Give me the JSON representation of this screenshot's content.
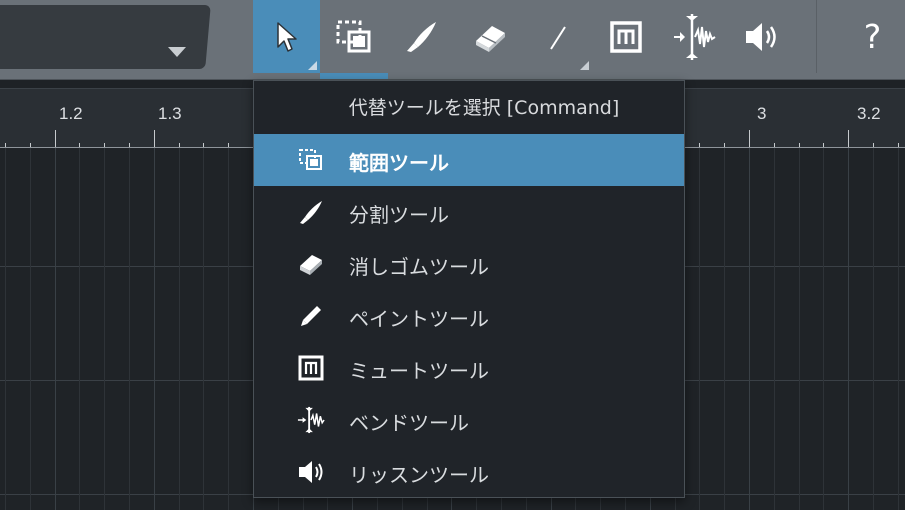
{
  "toolbar": {
    "tools": [
      {
        "name": "arrow-tool",
        "icon": "arrow-cursor-icon",
        "active": true,
        "has_submenu": true
      },
      {
        "name": "range-tool",
        "icon": "range-select-icon",
        "active": false,
        "has_submenu": false
      },
      {
        "name": "split-tool",
        "icon": "knife-icon",
        "active": false,
        "has_submenu": false
      },
      {
        "name": "eraser-tool",
        "icon": "eraser-icon",
        "active": false,
        "has_submenu": false
      },
      {
        "name": "paint-tool",
        "icon": "pencil-line-icon",
        "active": false,
        "has_submenu": true
      },
      {
        "name": "mute-tool",
        "icon": "mute-m-icon",
        "active": false,
        "has_submenu": false
      },
      {
        "name": "bend-tool",
        "icon": "bend-marker-icon",
        "active": false,
        "has_submenu": false
      },
      {
        "name": "listen-tool",
        "icon": "speaker-icon",
        "active": false,
        "has_submenu": false
      }
    ],
    "help_label": "?",
    "colors": {
      "toolbar": "#6a7178",
      "accent": "#4a8db9"
    }
  },
  "ruler": {
    "labels": [
      "1.2",
      "1.3",
      "3",
      "3.2"
    ]
  },
  "menu": {
    "header": "代替ツールを選択 [Command]",
    "items": [
      {
        "label": "範囲ツール",
        "icon": "range-select-icon",
        "selected": true
      },
      {
        "label": "分割ツール",
        "icon": "knife-icon",
        "selected": false
      },
      {
        "label": "消しゴムツール",
        "icon": "eraser-icon",
        "selected": false
      },
      {
        "label": "ペイントツール",
        "icon": "pencil-icon",
        "selected": false
      },
      {
        "label": "ミュートツール",
        "icon": "mute-m-icon",
        "selected": false
      },
      {
        "label": "ベンドツール",
        "icon": "bend-marker-icon",
        "selected": false
      },
      {
        "label": "リッスンツール",
        "icon": "speaker-icon",
        "selected": false
      }
    ]
  }
}
